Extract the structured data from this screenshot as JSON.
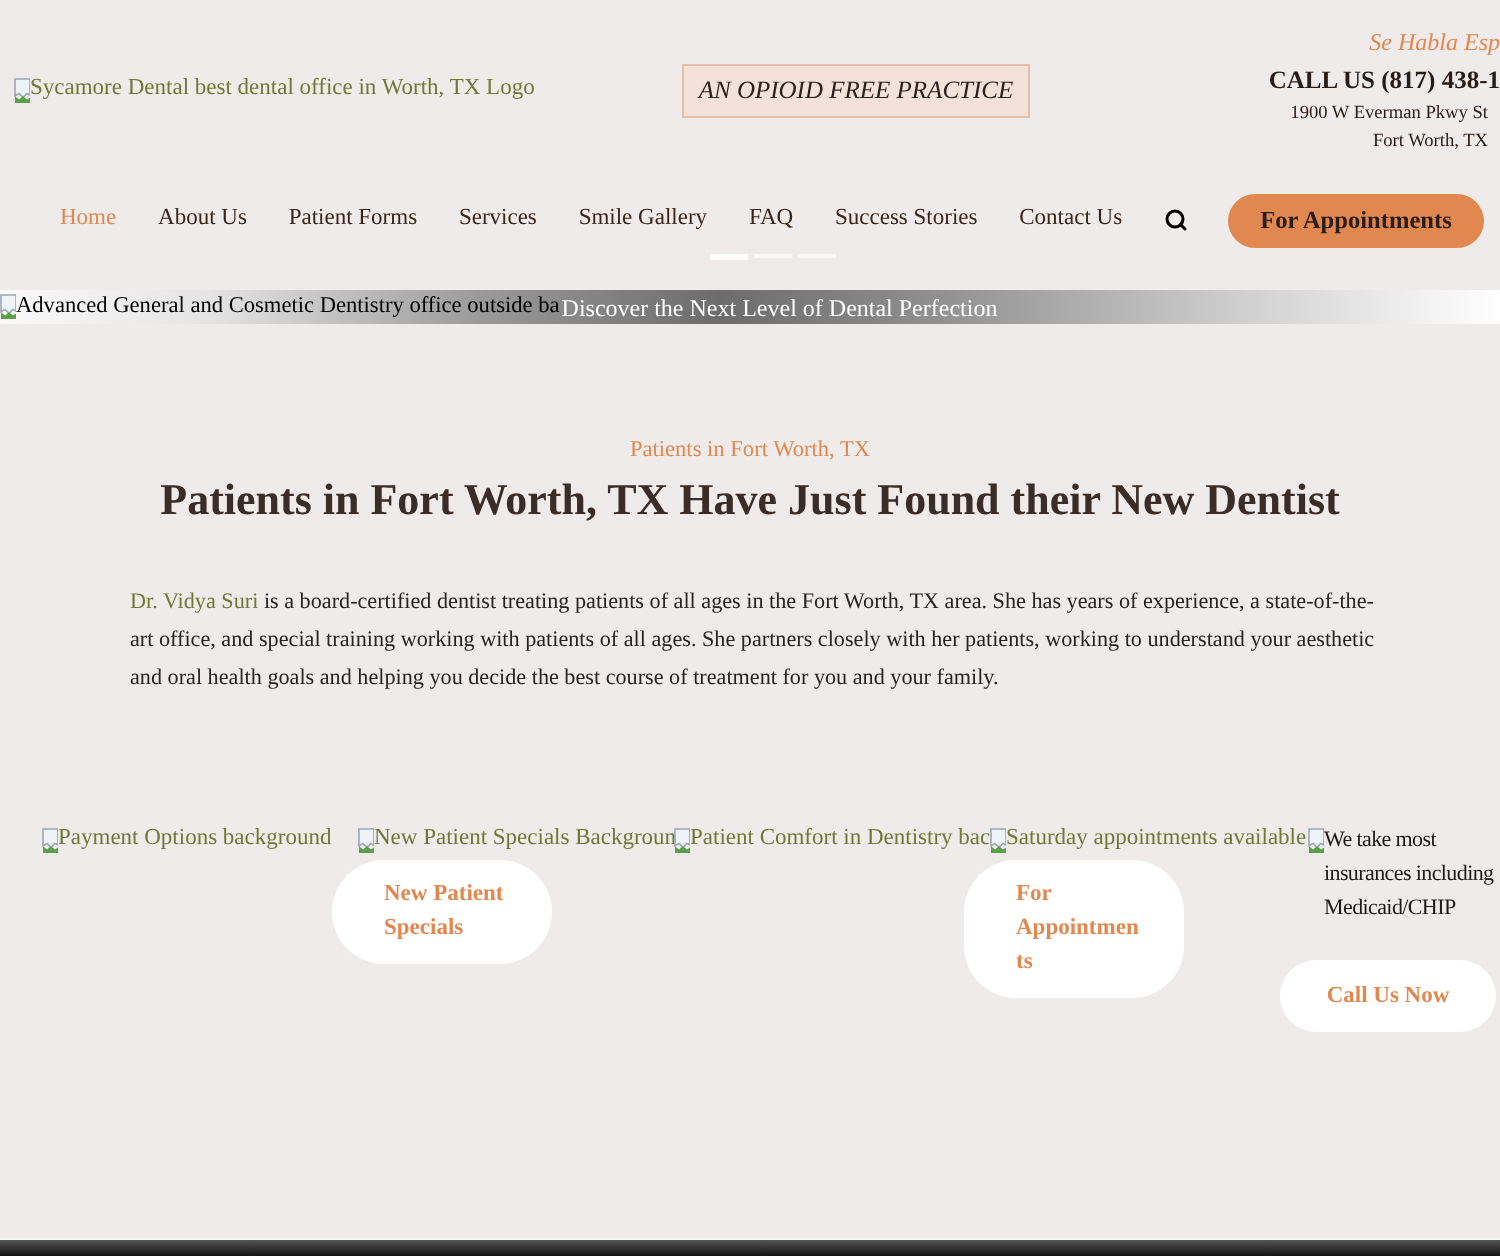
{
  "header": {
    "logo_alt": "Sycamore Dental best dental office in Worth, TX Logo",
    "badge": "AN OPIOID FREE PRACTICE",
    "spanish_note": "Se Habla Esp",
    "phone": "CALL US (817) 438-1",
    "address_lines": [
      "1900 W Everman Pkwy St",
      "Fort Worth, TX"
    ]
  },
  "nav": {
    "items": [
      {
        "label": "Home",
        "selected": true
      },
      {
        "label": "About Us",
        "selected": false
      },
      {
        "label": "Patient Forms",
        "selected": false
      },
      {
        "label": "Services",
        "selected": false
      },
      {
        "label": "Smile Gallery",
        "selected": false
      },
      {
        "label": "FAQ",
        "selected": false
      },
      {
        "label": "Success Stories",
        "selected": false
      },
      {
        "label": "Contact Us",
        "selected": false
      }
    ],
    "cta": "For Appointments"
  },
  "carousel_dots": [
    {
      "selected": true
    },
    {
      "selected": false
    },
    {
      "selected": false
    }
  ],
  "banner": {
    "image_alt": "Advanced General and Cosmetic Dentistry office outside ba",
    "tagline": "Discover the Next Level of Dental Perfection"
  },
  "intro": {
    "eyebrow": "Patients in Fort Worth, TX",
    "heading": "Patients in Fort Worth, TX Have Just Found their New Dentist",
    "doctor_link": "Dr. Vidya Suri",
    "text": "is a board-certified dentist treating patients of all ages in the Fort Worth, TX area. She has years of experience, a state-of-the-art office, and special training working with patients of all ages. She partners closely with her patients, working to understand your aesthetic and oral health goals and helping you decide the best course of treatment for you and your family."
  },
  "features": [
    {
      "kind": "image",
      "image_alt": "Payment Options background"
    },
    {
      "kind": "image",
      "image_alt": "New Patient Specials Backgroun",
      "button": "New Patient Specials"
    },
    {
      "kind": "image",
      "image_alt": "Patient Comfort in Dentistry bac"
    },
    {
      "kind": "image",
      "image_alt": "Saturday appointments available",
      "button": "For Appointments"
    },
    {
      "kind": "text",
      "text": "We take most insurances including Medicaid/CHIP",
      "button": "Call Us Now"
    }
  ]
}
